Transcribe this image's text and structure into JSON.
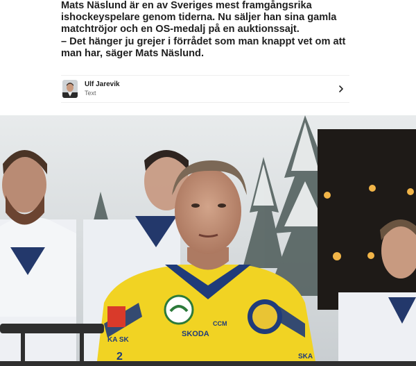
{
  "article": {
    "lead_text": "Mats Näslund är en av Sveriges mest framgångsrika ishockeyspelare genom tiderna. Nu säljer han sina gamla matchtröjor och en OS-medalj på en auktionssajt.",
    "quote_text": "– Det hänger ju grejer i förrådet som man knappt vet om att man har, säger Mats Näslund."
  },
  "author": {
    "name": "Ulf Jarevik",
    "role": "Text"
  },
  "photo": {
    "jersey_brand": "SKODA",
    "jersey_maker": "CCM",
    "jersey_partial_left": "KA SK",
    "jersey_partial_bottom": "SKA",
    "number_partial": "2"
  },
  "icons": {
    "chevron": "chevron-right-icon",
    "avatar": "author-avatar"
  }
}
